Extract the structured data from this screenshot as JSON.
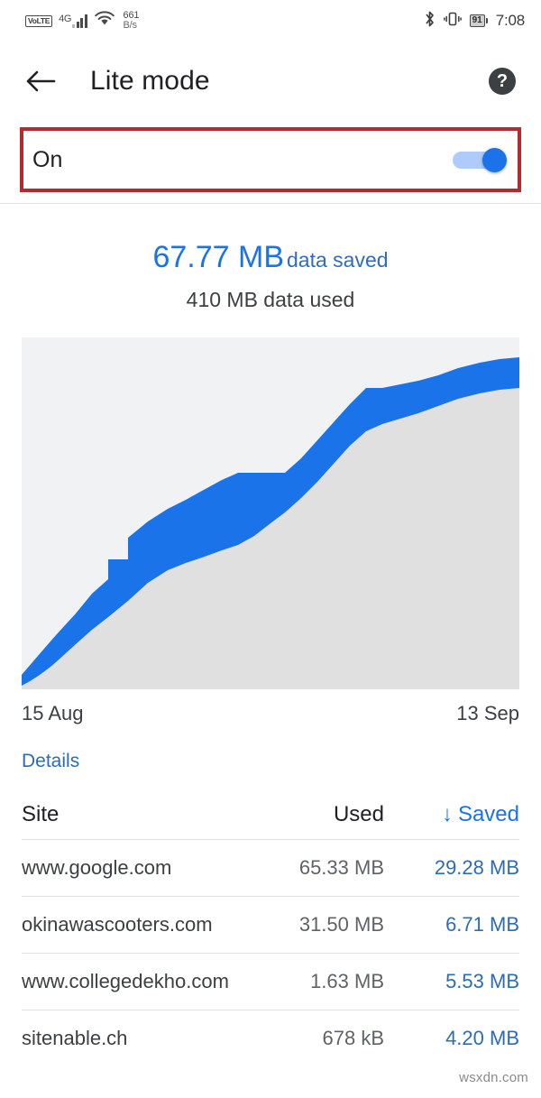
{
  "status_bar": {
    "volte": "VoLTE",
    "network_type": "4G",
    "data_rate_value": "661",
    "data_rate_unit": "B/s",
    "battery_percent": "91",
    "time": "7:08",
    "icons": [
      "volte-badge",
      "signal-bars-icon",
      "wifi-icon",
      "bluetooth-icon",
      "vibrate-icon",
      "battery-icon"
    ]
  },
  "toolbar": {
    "back_icon": "back-arrow-icon",
    "title": "Lite mode",
    "help_icon": "help-circle-icon",
    "help_glyph": "?"
  },
  "toggle": {
    "label": "On",
    "state": "on",
    "highlight_color": "#b42b2b"
  },
  "summary": {
    "saved_amount": "67.77 MB",
    "saved_caption": "data saved",
    "used_line": "410 MB data used",
    "accent_color": "#1a73e8"
  },
  "chart_axis": {
    "start_label": "15 Aug",
    "end_label": "13 Sep"
  },
  "details": {
    "label": "Details"
  },
  "table": {
    "headers": {
      "site": "Site",
      "used": "Used",
      "saved": "Saved",
      "sort_arrow": "↓",
      "sorted_by": "saved",
      "sort_direction": "descending"
    },
    "rows": [
      {
        "site": "www.google.com",
        "used": "65.33 MB",
        "saved": "29.28 MB"
      },
      {
        "site": "okinawascooters.com",
        "used": "31.50 MB",
        "saved": "6.71 MB"
      },
      {
        "site": "www.collegedekho.com",
        "used": "1.63 MB",
        "saved": "5.53 MB"
      },
      {
        "site": "sitenable.ch",
        "used": "678 kB",
        "saved": "4.20 MB"
      }
    ]
  },
  "watermark": {
    "text": "wsxdn.com"
  },
  "chart_data": {
    "type": "area",
    "title": "",
    "xlabel": "",
    "ylabel": "",
    "stacked": true,
    "grid": false,
    "legend_position": "none",
    "background_color": "#f1f2f3",
    "series": [
      {
        "name": "Data used",
        "color": "#e0e0e0",
        "values": [
          0,
          4,
          9,
          16,
          26,
          38,
          52,
          68,
          86,
          105,
          120,
          133,
          148,
          166,
          186,
          208,
          232,
          258,
          286,
          314,
          338,
          356,
          372,
          386,
          396,
          403,
          407,
          409,
          410,
          410
        ]
      },
      {
        "name": "Data saved",
        "color": "#1a73e8",
        "values": [
          0,
          1,
          2,
          3,
          5,
          7,
          10,
          13,
          17,
          22,
          26,
          30,
          33,
          36,
          40,
          43,
          46,
          49,
          52,
          55,
          58,
          60,
          62,
          64,
          65,
          66,
          67,
          67.4,
          67.6,
          67.77
        ]
      }
    ],
    "x": [
      "15 Aug",
      "16 Aug",
      "17 Aug",
      "18 Aug",
      "19 Aug",
      "20 Aug",
      "21 Aug",
      "22 Aug",
      "23 Aug",
      "24 Aug",
      "25 Aug",
      "26 Aug",
      "27 Aug",
      "28 Aug",
      "29 Aug",
      "30 Aug",
      "31 Aug",
      "1 Sep",
      "2 Sep",
      "3 Sep",
      "4 Sep",
      "5 Sep",
      "6 Sep",
      "7 Sep",
      "8 Sep",
      "9 Sep",
      "10 Sep",
      "11 Sep",
      "12 Sep",
      "13 Sep"
    ],
    "xlim": [
      "15 Aug",
      "13 Sep"
    ],
    "ylim": [
      0,
      478
    ],
    "tick_labels": [
      "15 Aug",
      "13 Sep"
    ]
  }
}
